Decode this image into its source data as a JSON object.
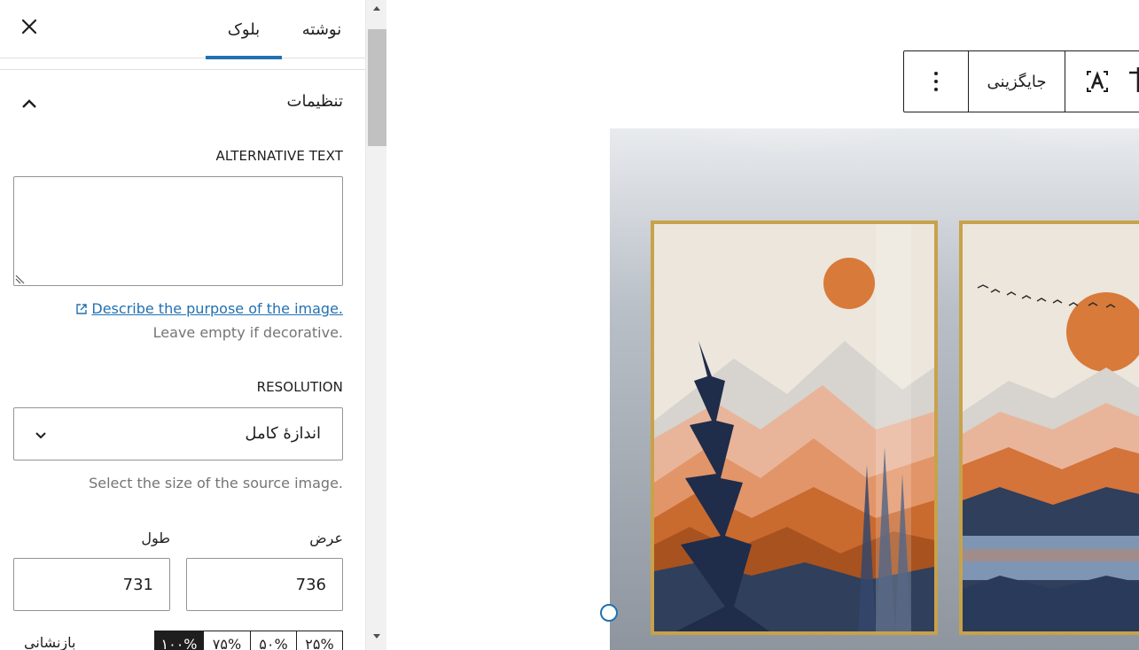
{
  "sidebar": {
    "tabs": {
      "post": "نوشته",
      "block": "بلوک"
    },
    "panel_title": "تنظیمات",
    "alt_text": {
      "label": "ALTERNATIVE TEXT",
      "value": "",
      "help_link": "Describe the purpose of the image.",
      "help_note": "Leave empty if decorative."
    },
    "resolution": {
      "label": "RESOLUTION",
      "selected": "اندازهٔ کامل",
      "help": "Select the size of the source image."
    },
    "dimensions": {
      "width_label": "عرض",
      "height_label": "طول",
      "width_value": "736",
      "height_value": "731"
    },
    "scale": {
      "reset_label": "بازنشانی",
      "options": [
        "۲۵%",
        "۵۰%",
        "۷۵%",
        "۱۰۰%"
      ],
      "active_index": 3
    }
  },
  "toolbar": {
    "replace_label": "جایگزینی"
  },
  "colors": {
    "accent": "#2271b1",
    "border": "#949494"
  }
}
